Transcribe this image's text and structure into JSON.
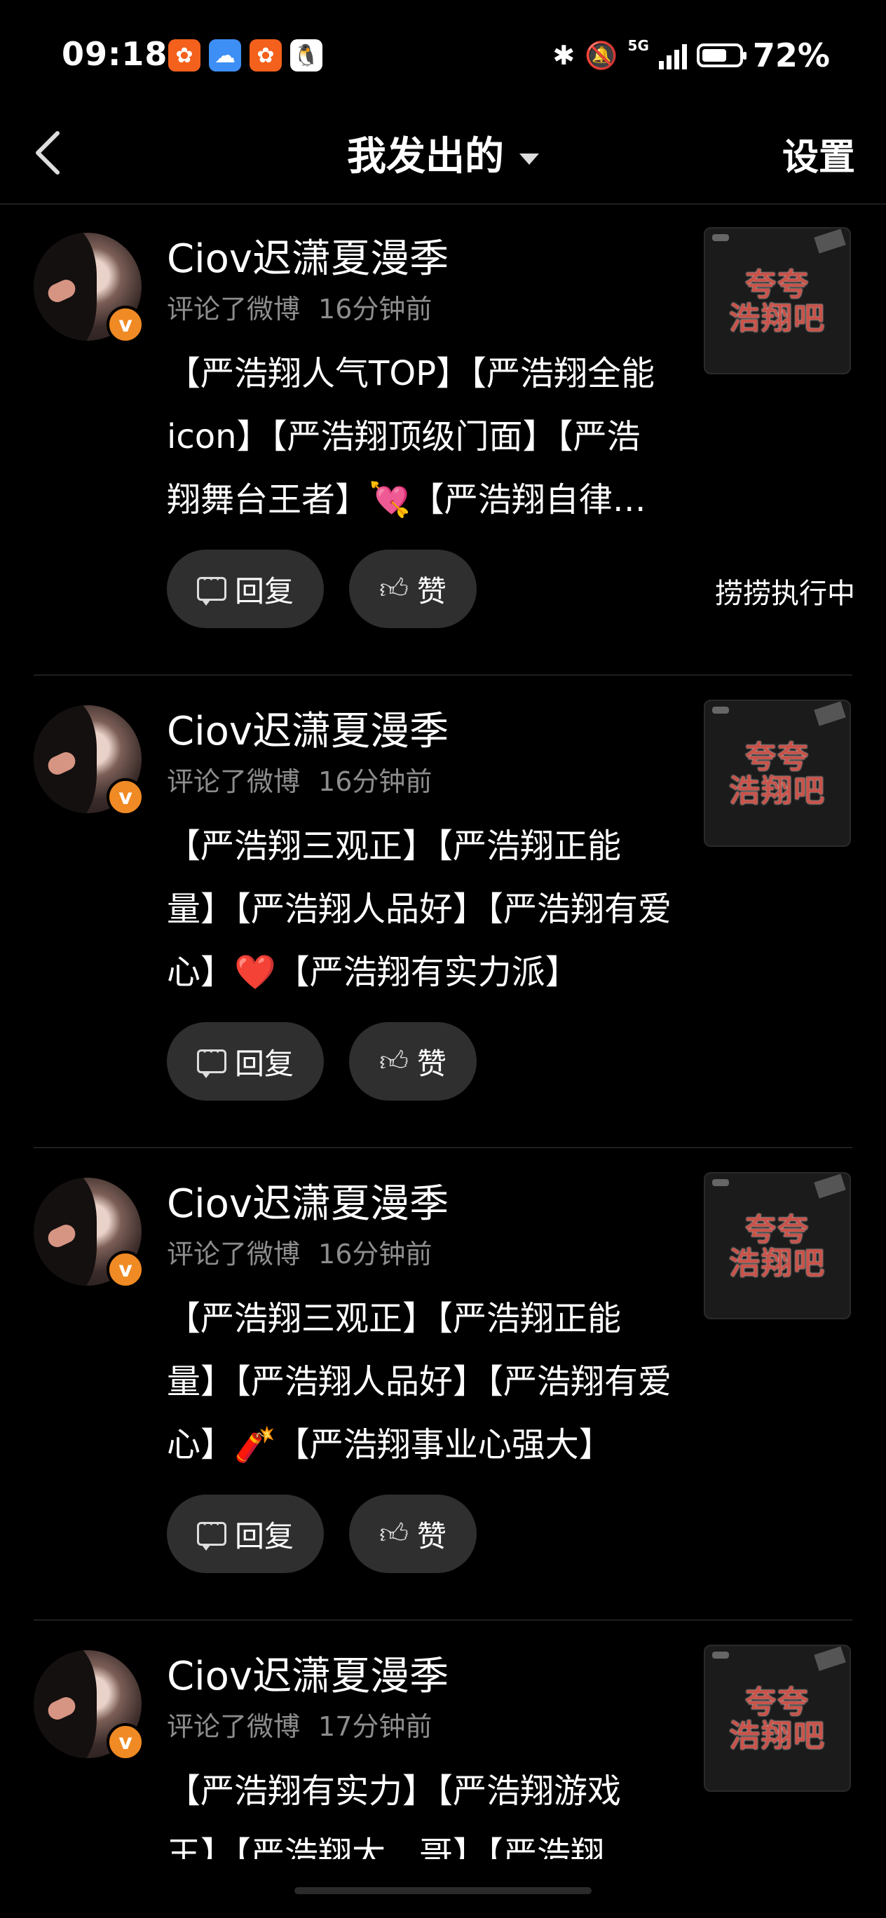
{
  "status_bar": {
    "time": "09:18",
    "network": "5G",
    "battery_level": 0.72,
    "battery": "72%",
    "app_icons": [
      "orange-app-icon",
      "weather-app-icon",
      "orange-app-icon",
      "qq-icon"
    ]
  },
  "nav": {
    "title": "我发出的",
    "settings": "设置"
  },
  "items": [
    {
      "username": "Ciov迟潇夏漫季",
      "action": "评论了微博",
      "time": "16分钟前",
      "content": "【严浩翔人气TOP】【严浩翔全能icon】【严浩翔顶级门面】【严浩翔舞台王者】💘【严浩翔自律又努力】",
      "reply_label": "回复",
      "like_label": "赞",
      "side_status": "捞捞执行中",
      "thumb_line1": "夸夸",
      "thumb_line2": "浩翔吧"
    },
    {
      "username": "Ciov迟潇夏漫季",
      "action": "评论了微博",
      "time": "16分钟前",
      "content": "【严浩翔三观正】【严浩翔正能量】【严浩翔人品好】【严浩翔有爱心】❤️【严浩翔有实力派】",
      "reply_label": "回复",
      "like_label": "赞",
      "thumb_line1": "夸夸",
      "thumb_line2": "浩翔吧"
    },
    {
      "username": "Ciov迟潇夏漫季",
      "action": "评论了微博",
      "time": "16分钟前",
      "content": "【严浩翔三观正】【严浩翔正能量】【严浩翔人品好】【严浩翔有爱心】🧨【严浩翔事业心强大】",
      "reply_label": "回复",
      "like_label": "赞",
      "thumb_line1": "夸夸",
      "thumb_line2": "浩翔吧"
    },
    {
      "username": "Ciov迟潇夏漫季",
      "action": "评论了微博",
      "time": "17分钟前",
      "content": "【严浩翔有实力】【严浩翔游戏王】【严浩翔大…哥】【严浩翔",
      "reply_label": "回复",
      "like_label": "赞",
      "thumb_line1": "夸夸",
      "thumb_line2": "浩翔吧"
    }
  ]
}
